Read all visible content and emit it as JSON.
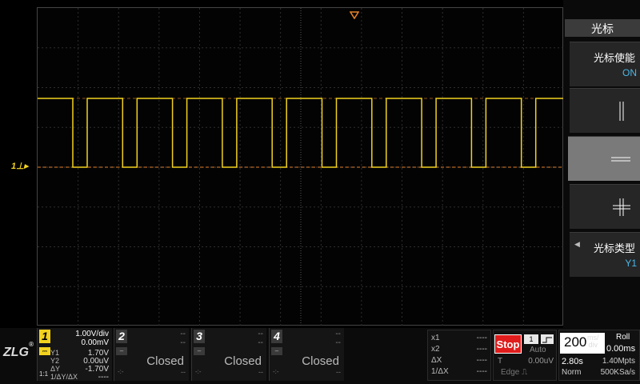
{
  "menu": {
    "title": "光标",
    "enable_label": "光标使能",
    "enable_value": "ON",
    "cursor_type_label": "光标类型",
    "cursor_type_value": "Y1"
  },
  "waveform": {
    "channel_marker": "1",
    "trace_color": "#f2d21e",
    "high_level_v": 1.7,
    "low_level_v": 0.0,
    "grid": "on"
  },
  "channels": [
    {
      "num": "1",
      "scale": "1.00V/div",
      "offset": "0.00mV",
      "y1_label": "Y1",
      "y1_value": "1.70V",
      "y2_label": "Y2",
      "y2_value": "0.00uV",
      "dy_label": "ΔY",
      "dy_value": "-1.70V",
      "ratio_label": "1/ΔY/ΔX",
      "ratio_value": "----",
      "probe": "1:1"
    },
    {
      "num": "2",
      "scale": "--",
      "offset": "--",
      "state": "Closed",
      "foot_l": "-:-",
      "foot_r": "--"
    },
    {
      "num": "3",
      "scale": "--",
      "offset": "--",
      "state": "Closed",
      "foot_l": "-:-",
      "foot_r": "--"
    },
    {
      "num": "4",
      "scale": "--",
      "offset": "--",
      "state": "Closed",
      "foot_l": "-:-",
      "foot_r": "--"
    }
  ],
  "cursor_readout": [
    {
      "label": "x1",
      "value": "----"
    },
    {
      "label": "x2",
      "value": "----"
    },
    {
      "label": "ΔX",
      "value": "----"
    },
    {
      "label": "1/ΔX",
      "value": "----"
    }
  ],
  "trigger": {
    "run_state": "Stop",
    "source": "1",
    "mode": "Auto",
    "t_label": "T",
    "level": "0.00uV",
    "type": "Edge"
  },
  "timebase": {
    "value": "200",
    "unit_top": "ms/",
    "unit_bottom": "div",
    "mode": "Roll",
    "offset": "0.00ms",
    "delay": "2.80s",
    "memory": "1.40Mpts",
    "acq": "Norm",
    "sample_rate": "500KSa/s"
  },
  "logo": "ZLG",
  "logo_reg": "®"
}
